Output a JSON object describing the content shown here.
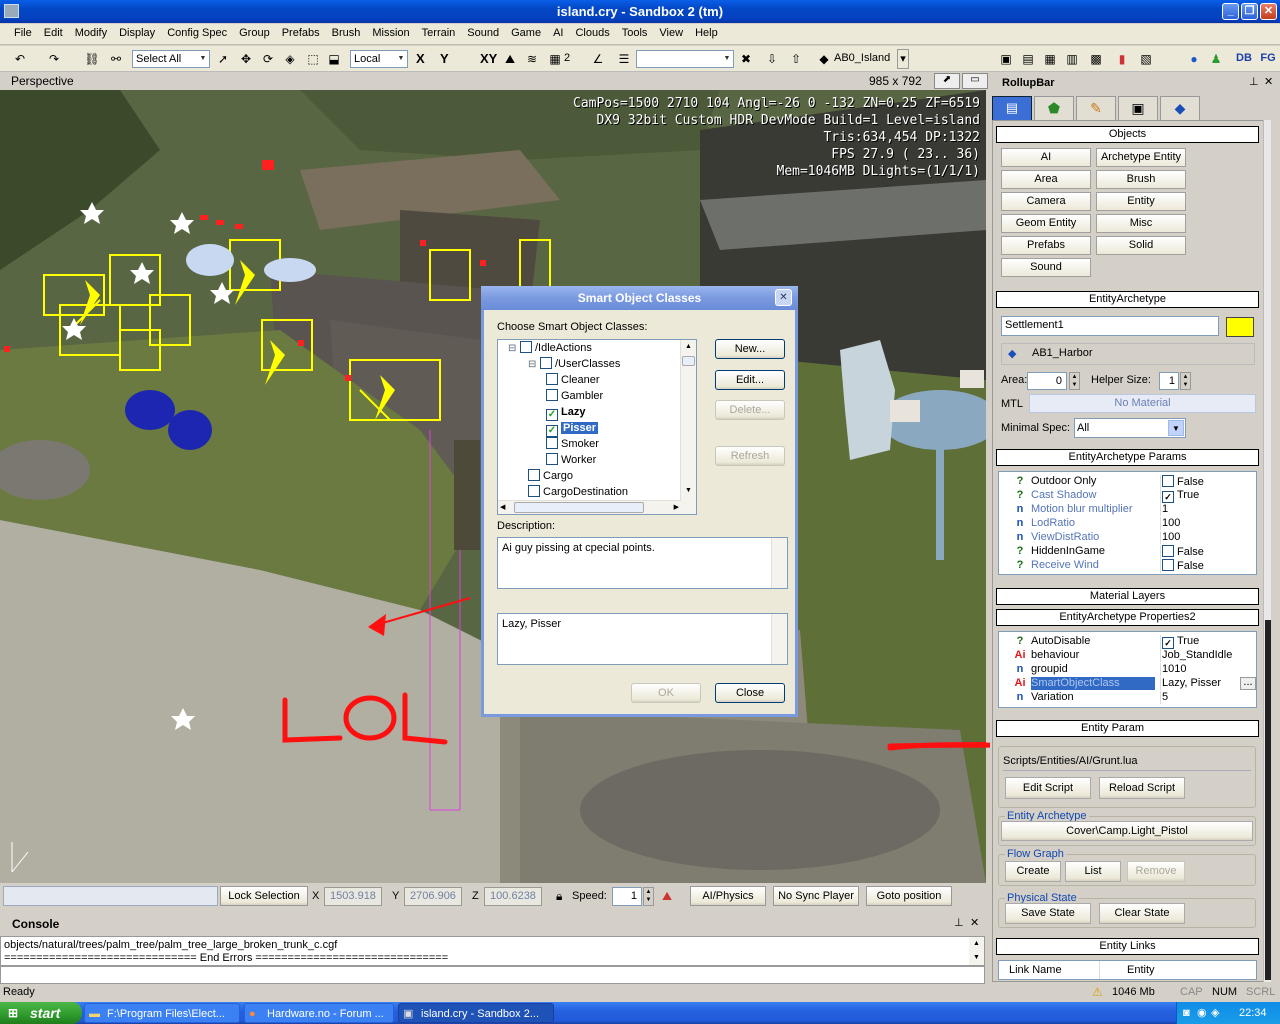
{
  "window": {
    "title": "island.cry - Sandbox 2 (tm)"
  },
  "menu": [
    "File",
    "Edit",
    "Modify",
    "Display",
    "Config Spec",
    "Group",
    "Prefabs",
    "Brush",
    "Mission",
    "Terrain",
    "Sound",
    "Game",
    "AI",
    "Clouds",
    "Tools",
    "View",
    "Help"
  ],
  "toolbar": {
    "select_combo": "Select All",
    "coord_combo": "Local",
    "axes": [
      "X",
      "Y",
      "XY"
    ],
    "grid_value": "2",
    "level_combo": "AB0_Island"
  },
  "toolbar2": {
    "db_label": "DB",
    "fg_label": "FG"
  },
  "viewport": {
    "name": "Perspective",
    "resolution": "985 x 792",
    "hud": [
      "CamPos=1500 2710 104 Angl=-26  0 -132 ZN=0.25 ZF=6519",
      "DX9 32bit Custom HDR DevMode Build=1 Level=island",
      "Tris:634,454  DP:1322",
      "FPS  27.9 ( 23.. 36)",
      "Mem=1046MB DLights=(1/1/1)"
    ],
    "overlay_text": "LOL",
    "overlay_color": "#ff1010"
  },
  "dialog": {
    "title": "Smart Object Classes",
    "choose_label": "Choose Smart Object Classes:",
    "tree": [
      {
        "label": "/IdleActions",
        "checked": false,
        "bold": false,
        "selected": false
      },
      {
        "label": "/UserClasses",
        "checked": false,
        "bold": false,
        "selected": false
      },
      {
        "label": "Cleaner",
        "checked": false,
        "bold": false,
        "selected": false
      },
      {
        "label": "Gambler",
        "checked": false,
        "bold": false,
        "selected": false
      },
      {
        "label": "Lazy",
        "checked": true,
        "bold": true,
        "selected": false
      },
      {
        "label": "Pisser",
        "checked": true,
        "bold": true,
        "selected": true
      },
      {
        "label": "Smoker",
        "checked": false,
        "bold": false,
        "selected": false
      },
      {
        "label": "Worker",
        "checked": false,
        "bold": false,
        "selected": false
      },
      {
        "label": "Cargo",
        "checked": false,
        "bold": false,
        "selected": false
      },
      {
        "label": "CargoDestination",
        "checked": false,
        "bold": false,
        "selected": false
      }
    ],
    "buttons": {
      "new": "New...",
      "edit": "Edit...",
      "delete": "Delete...",
      "refresh": "Refresh",
      "ok": "OK",
      "close": "Close"
    },
    "description_label": "Description:",
    "description": "Ai guy pissing at cpecial points.",
    "selection": "Lazy, Pisser"
  },
  "rollup": {
    "title": "RollupBar",
    "objects_header": "Objects",
    "objects": [
      "AI",
      "Archetype Entity",
      "Area",
      "Brush",
      "Camera",
      "Entity",
      "Geom Entity",
      "Misc",
      "Prefabs",
      "Solid",
      "Sound"
    ],
    "archetype_header": "EntityArchetype",
    "archetype_name": "Settlement1",
    "archetype_color": "#ffff00",
    "library": "AB1_Harbor",
    "area_label": "Area:",
    "area_value": "0",
    "helper_label": "Helper Size:",
    "helper_value": "1",
    "mtl_label": "MTL",
    "mtl_value": "No Material",
    "minspec_label": "Minimal Spec:",
    "minspec_value": "All",
    "params_header": "EntityArchetype Params",
    "params": [
      {
        "icon": "?",
        "name": "Outdoor Only",
        "value": "False",
        "check": true,
        "checked": false,
        "dim": false
      },
      {
        "icon": "?",
        "name": "Cast Shadow",
        "value": "True",
        "check": true,
        "checked": true,
        "dim": true
      },
      {
        "icon": "n",
        "name": "Motion blur multiplier",
        "value": "1",
        "check": false,
        "checked": false,
        "dim": true
      },
      {
        "icon": "n",
        "name": "LodRatio",
        "value": "100",
        "check": false,
        "checked": false,
        "dim": true
      },
      {
        "icon": "n",
        "name": "ViewDistRatio",
        "value": "100",
        "check": false,
        "checked": false,
        "dim": true
      },
      {
        "icon": "?",
        "name": "HiddenInGame",
        "value": "False",
        "check": true,
        "checked": false,
        "dim": false
      },
      {
        "icon": "?",
        "name": "Receive Wind",
        "value": "False",
        "check": true,
        "checked": false,
        "dim": true
      }
    ],
    "material_header": "Material Layers",
    "props2_header": "EntityArchetype Properties2",
    "props2": [
      {
        "icon": "?",
        "name": "AutoDisable",
        "value": "True",
        "check": true,
        "checked": true,
        "sel": false
      },
      {
        "icon": "Ai",
        "name": "behaviour",
        "value": "Job_StandIdle",
        "check": false,
        "checked": false,
        "sel": false
      },
      {
        "icon": "n",
        "name": "groupid",
        "value": "1010",
        "check": false,
        "checked": false,
        "sel": false
      },
      {
        "icon": "Ai",
        "name": "SmartObjectClass",
        "value": "Lazy, Pisser",
        "check": false,
        "checked": false,
        "sel": true
      },
      {
        "icon": "n",
        "name": "Variation",
        "value": "5",
        "check": false,
        "checked": false,
        "sel": false
      }
    ],
    "entity_param_header": "Entity Param",
    "script_path": "Scripts/Entities/AI/Grunt.lua",
    "edit_script": "Edit Script",
    "reload_script": "Reload Script",
    "entity_archetype_label": "Entity Archetype",
    "entity_archetype_value": "Cover\\Camp.Light_Pistol",
    "flow_graph_label": "Flow Graph",
    "fg_create": "Create",
    "fg_list": "List",
    "fg_remove": "Remove",
    "physical_state_label": "Physical State",
    "save_state": "Save State",
    "clear_state": "Clear State",
    "entity_links_header": "Entity Links",
    "links_col1": "Link Name",
    "links_col2": "Entity"
  },
  "bottombar": {
    "lock_selection": "Lock Selection",
    "x_label": "X",
    "x_value": "1503.918",
    "y_label": "Y",
    "y_value": "2706.906",
    "z_label": "Z",
    "z_value": "100.6238",
    "speed_label": "Speed:",
    "speed_value": "1",
    "ai_physics": "AI/Physics",
    "no_sync": "No Sync Player",
    "goto": "Goto position"
  },
  "console": {
    "title": "Console",
    "lines": [
      "objects/natural/trees/palm_tree/palm_tree_large_broken_trunk_c.cgf",
      "============================== End Errors =============================="
    ]
  },
  "status": {
    "ready": "Ready",
    "mem": "1046 Mb",
    "cap": "CAP",
    "num": "NUM",
    "scrl": "SCRL"
  },
  "taskbar": {
    "start": "start",
    "tasks": [
      "F:\\Program Files\\Elect...",
      "Hardware.no - Forum ...",
      "island.cry - Sandbox 2..."
    ],
    "clock": "22:34"
  }
}
